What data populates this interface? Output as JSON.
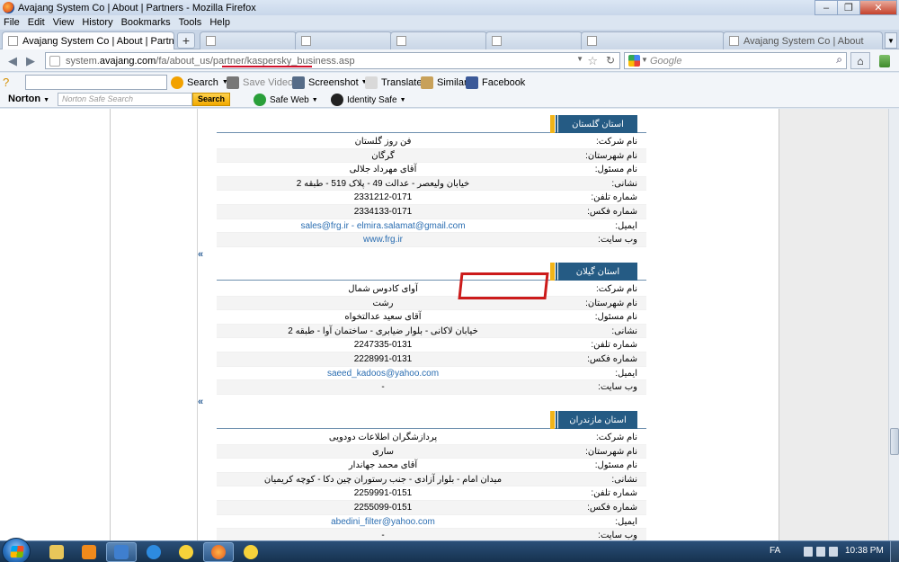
{
  "window": {
    "title": "Avajang System Co | About | Partners - Mozilla Firefox",
    "minimize": "–",
    "maximize": "❐",
    "close": "✕"
  },
  "menu": [
    "File",
    "Edit",
    "View",
    "History",
    "Bookmarks",
    "Tools",
    "Help"
  ],
  "tabs": [
    {
      "label": "Avajang System Co | About | Partners",
      "active": true
    },
    {
      "label": "",
      "active": false
    },
    {
      "label": "",
      "active": false
    },
    {
      "label": "",
      "active": false
    },
    {
      "label": "",
      "active": false
    },
    {
      "label": "",
      "active": false
    },
    {
      "label": "Avajang System Co | About",
      "active": false
    }
  ],
  "new_tab": "+",
  "url": {
    "prefix": "system.",
    "host": "avajang.com",
    "path": "/fa/about_us/partner/kaspersky_business.asp"
  },
  "search": {
    "placeholder": "Google"
  },
  "toolbar": {
    "search_label": "Search",
    "save_video": "Save Video",
    "screenshot": "Screenshot",
    "translate": "Translate",
    "similar": "Similar",
    "facebook": "Facebook"
  },
  "norton": {
    "brand": "Norton",
    "placeholder": "Norton Safe Search",
    "search_button": "Search",
    "safe_web": "Safe Web",
    "identity_safe": "Identity Safe"
  },
  "labels": {
    "company": "نام شرکت:",
    "city": "نام شهرستان:",
    "manager": "نام مسئول:",
    "address": "نشانی:",
    "phone": "شماره تلفن:",
    "fax": "شماره فکس:",
    "email": "ایمیل:",
    "website": "وب سایت:"
  },
  "sections": [
    {
      "province": "استان گلستان",
      "company": "فن روز گلستان",
      "city": "گرگان",
      "manager": "آقای مهرداد جلالی",
      "address": "خیابان ولیعصر - عدالت 49 - پلاک 519 - طبقه 2",
      "phone": "2331212-0171",
      "fax": "2334133-0171",
      "email": "sales@frg.ir - elmira.salamat@gmail.com",
      "website": "www.frg.ir"
    },
    {
      "province": "استان گیلان",
      "company": "آوای کادوس شمال",
      "city": "رشت",
      "manager": "آقای سعید عدالتخواه",
      "address": "خیابان لاکانی - بلوار ضیابری - ساختمان آوا - طبقه 2",
      "phone": "2247335-0131",
      "fax": "2228991-0131",
      "email": "saeed_kadoos@yahoo.com",
      "website": "-"
    },
    {
      "province": "استان مازندران",
      "company": "پردازشگران اطلاعات دودویی",
      "city": "ساری",
      "manager": "آقای محمد جهاندار",
      "address": "میدان امام - بلوار آزادی - جنب رستوران چین دکا - کوچه کریمیان",
      "phone": "2259991-0151",
      "fax": "2255099-0151",
      "email": "abedini_filter@yahoo.com",
      "website": "-"
    }
  ],
  "back_to_top": "«",
  "taskbar": {
    "lang": "FA",
    "time": "10:38 PM"
  }
}
